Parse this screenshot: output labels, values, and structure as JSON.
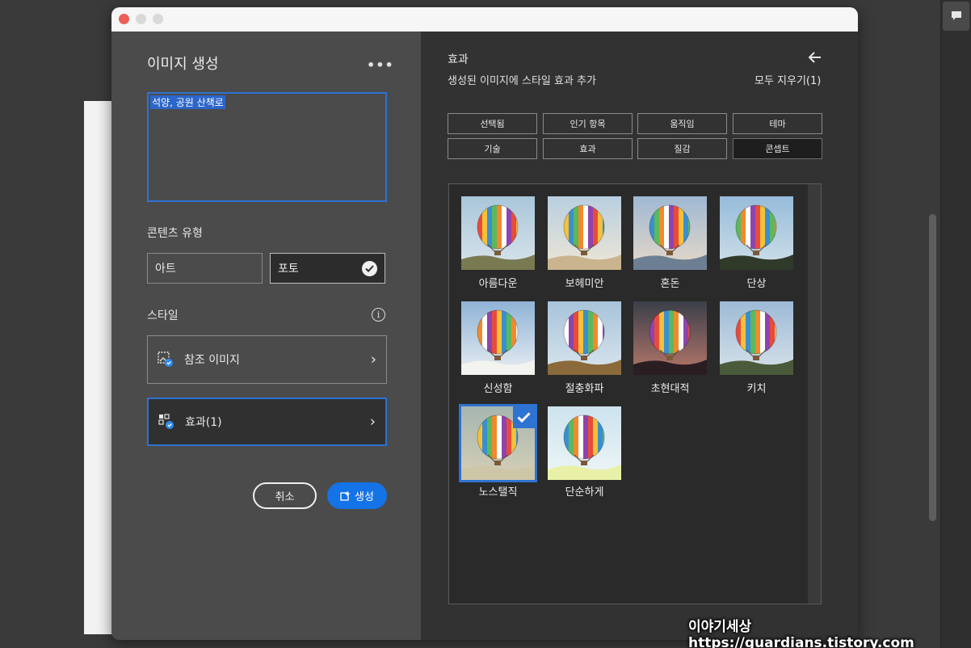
{
  "left_panel": {
    "title": "이미지 생성",
    "more_icon": "more-horizontal-icon",
    "prompt": "석양, 공원 산책로",
    "content_type_label": "콘텐츠 유형",
    "content_types": [
      "아트",
      "포토"
    ],
    "content_type_selected": "포토",
    "style_label": "스타일",
    "reference_image_label": "참조 이미지",
    "effects_label": "효과(1)",
    "cancel_label": "취소",
    "generate_label": "생성"
  },
  "right_panel": {
    "title": "효과",
    "subtitle": "생성된 이미지에 스타일 효과 추가",
    "clear_all": "모두 지우기(1)",
    "tags": [
      "선택됨",
      "인기 항목",
      "움직임",
      "테마",
      "기술",
      "효과",
      "질감",
      "콘셉트"
    ],
    "active_tag": "콘셉트",
    "effects": [
      {
        "label": "아름다운",
        "selected": false
      },
      {
        "label": "보헤미안",
        "selected": false
      },
      {
        "label": "혼돈",
        "selected": false
      },
      {
        "label": "단상",
        "selected": false
      },
      {
        "label": "신성함",
        "selected": false
      },
      {
        "label": "절충화파",
        "selected": false
      },
      {
        "label": "초현대적",
        "selected": false
      },
      {
        "label": "키치",
        "selected": false
      },
      {
        "label": "노스탤직",
        "selected": true
      },
      {
        "label": "단순하게",
        "selected": false
      }
    ]
  },
  "watermark": "이야기세상 https://guardians.tistory.com"
}
